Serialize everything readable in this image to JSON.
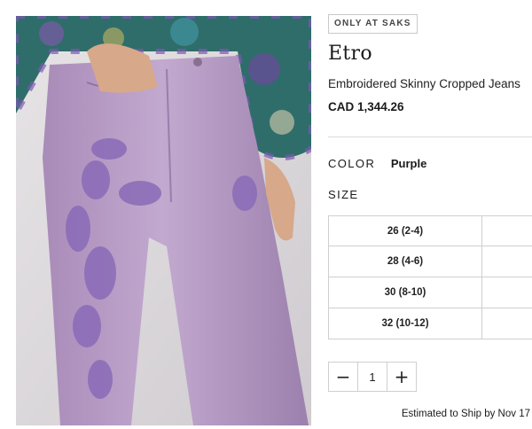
{
  "badge": "ONLY AT SAKS",
  "brand": "Etro",
  "product_name": "Embroidered Skinny Cropped Jeans",
  "price": "CAD 1,344.26",
  "color": {
    "label": "COLOR",
    "value": "Purple"
  },
  "size": {
    "label": "SIZE",
    "options": [
      "26 (2-4)",
      "28 (4-6)",
      "30 (8-10)",
      "32 (10-12)"
    ]
  },
  "quantity": {
    "decrement": "−",
    "value": "1",
    "increment": "+"
  },
  "shipping": "Estimated to Ship by Nov 17",
  "colors": {
    "denim": "#b79ac4",
    "embroidery": "#8a6bb8",
    "blouse": "#2f6d6a"
  },
  "icons": {
    "photo": "product-image",
    "minus": "minus-icon",
    "plus": "plus-icon"
  }
}
